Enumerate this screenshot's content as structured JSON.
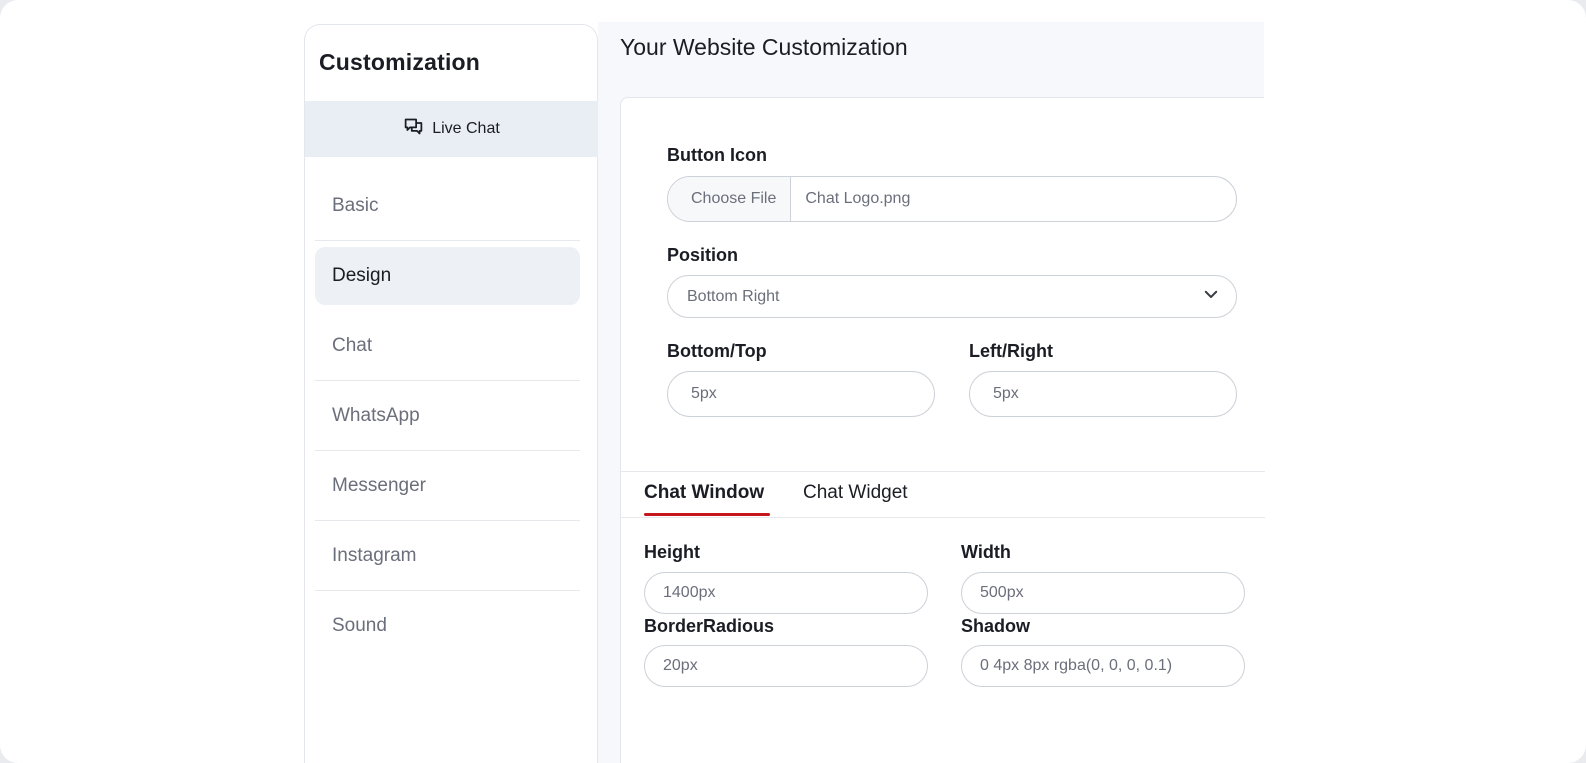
{
  "sidebar": {
    "title": "Customization",
    "live_chat_label": "Live Chat",
    "items": [
      {
        "label": "Basic"
      },
      {
        "label": "Design"
      },
      {
        "label": "Chat"
      },
      {
        "label": "WhatsApp"
      },
      {
        "label": "Messenger"
      },
      {
        "label": "Instagram"
      },
      {
        "label": "Sound"
      }
    ],
    "active_item": "Design"
  },
  "main": {
    "title": "Your Website Customization",
    "button_icon": {
      "label": "Button Icon",
      "choose_file": "Choose File",
      "file_name": "Chat Logo.png"
    },
    "position": {
      "label": "Position",
      "value": "Bottom Right"
    },
    "bottom_top": {
      "label": "Bottom/Top",
      "value": "5px"
    },
    "left_right": {
      "label": "Left/Right",
      "value": "5px"
    },
    "tabs": [
      {
        "label": "Chat Window",
        "active": true
      },
      {
        "label": "Chat Widget",
        "active": false
      }
    ],
    "height": {
      "label": "Height",
      "value": "1400px"
    },
    "width": {
      "label": "Width",
      "value": "500px"
    },
    "border_radius": {
      "label": "BorderRadious",
      "value": "20px"
    },
    "shadow": {
      "label": "Shadow",
      "value": "0 4px 8px rgba(0, 0, 0, 0.1)"
    }
  },
  "colors": {
    "accent": "#c4161c",
    "active_bg": "#edf0f4",
    "live_chat_bg": "#e9eef4"
  },
  "icons": {
    "live_chat": "chat-bubbles-icon",
    "select": "chevron-down-icon"
  }
}
